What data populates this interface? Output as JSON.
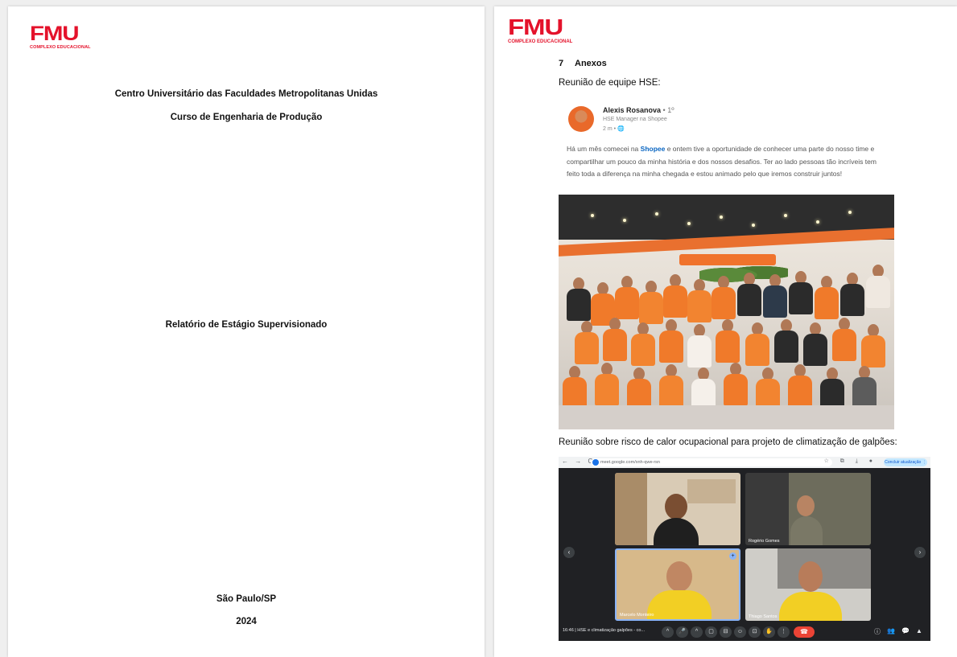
{
  "page1": {
    "logo": {
      "word": "FMU",
      "sub": "COMPLEXO EDUCACIONAL"
    },
    "institution": "Centro Universitário das Faculdades Metropolitanas Unidas",
    "course": "Curso de Engenharia de Produção",
    "report_title": "Relatório de Estágio Supervisionado",
    "city": "São Paulo/SP",
    "year": "2024"
  },
  "page2": {
    "logo": {
      "word": "FMU",
      "sub": "COMPLEXO EDUCACIONAL"
    },
    "section_number": "7",
    "section_title": "Anexos",
    "caption1": "Reunião de equipe HSE:",
    "post": {
      "author": "Alexis Rosanova",
      "degree": "• 1º",
      "role": "HSE Manager na Shopee",
      "meta": "2 m • 🌐",
      "text_before": "Há um mês comecei na ",
      "brand": "Shopee",
      "text_after": " e ontem tive a oportunidade de conhecer uma parte do nosso time e compartilhar um pouco da minha história e dos nossos desafios. Ter ao lado pessoas tão incríveis tem feito toda a diferença na minha chegada e estou animado pelo que iremos construir juntos!"
    },
    "caption2": "Reunião sobre risco de calor ocupacional para projeto de climatização de galpões:",
    "meet": {
      "nav_icons": "← → C",
      "url": "meet.google.com/xnh-qwe-rsn",
      "browser_icons": "☆ ⧉ ⤓ ●",
      "right_button": "Concluir atualização ⋮",
      "participants": [
        "",
        "Rogério Gomes",
        "Marcelo Monteiro",
        "Thiago Santos"
      ],
      "time_label": "16:46 | HSE e climatização galpões - co...",
      "controls": [
        "^",
        "🎤",
        "^",
        "▢",
        "⊟",
        "☺",
        "⊡",
        "✋",
        "⋮"
      ],
      "end_call_icon": "☎",
      "right_controls": [
        "ⓘ",
        "👥",
        "💬",
        "▲"
      ],
      "left_arrow": "‹",
      "right_arrow": "›",
      "badge_icon": "+"
    }
  },
  "colors": {
    "brand_red": "#e4122b",
    "shopee_orange": "#ee4d2d",
    "meet_dark": "#202124"
  }
}
